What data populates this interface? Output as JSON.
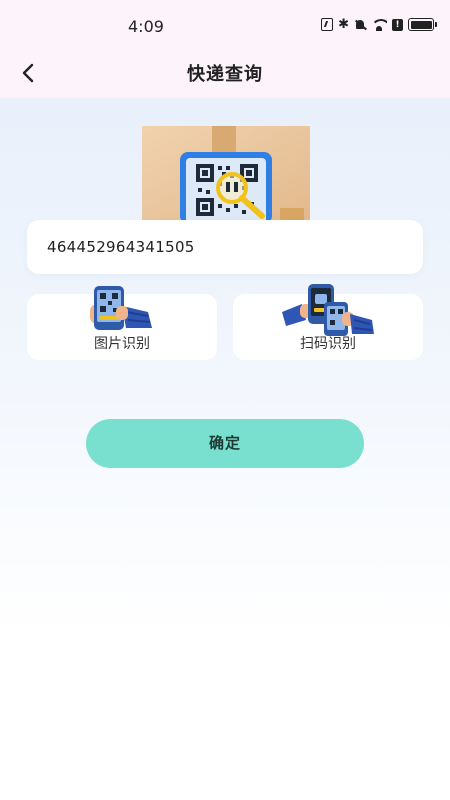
{
  "status_bar": {
    "time": "4:09",
    "icons": [
      "nfc-icon",
      "bluetooth-icon",
      "mute-bell-icon",
      "wifi-icon",
      "alert-icon",
      "battery-icon"
    ]
  },
  "header": {
    "back_icon": "chevron-left-icon",
    "title": "快递查询"
  },
  "search": {
    "tracking_number": "464452964341505"
  },
  "recognition": {
    "image": {
      "label": "图片识别",
      "icon": "phone-qr-hand-icon"
    },
    "scan": {
      "label": "扫码识别",
      "icon": "phone-scan-hand-icon"
    }
  },
  "confirm": {
    "label": "确定",
    "color": "#79dfcf"
  },
  "colors": {
    "header_bg": "#fdf4fb",
    "content_bg": "#e8f0fb",
    "accent": "#79dfcf"
  }
}
